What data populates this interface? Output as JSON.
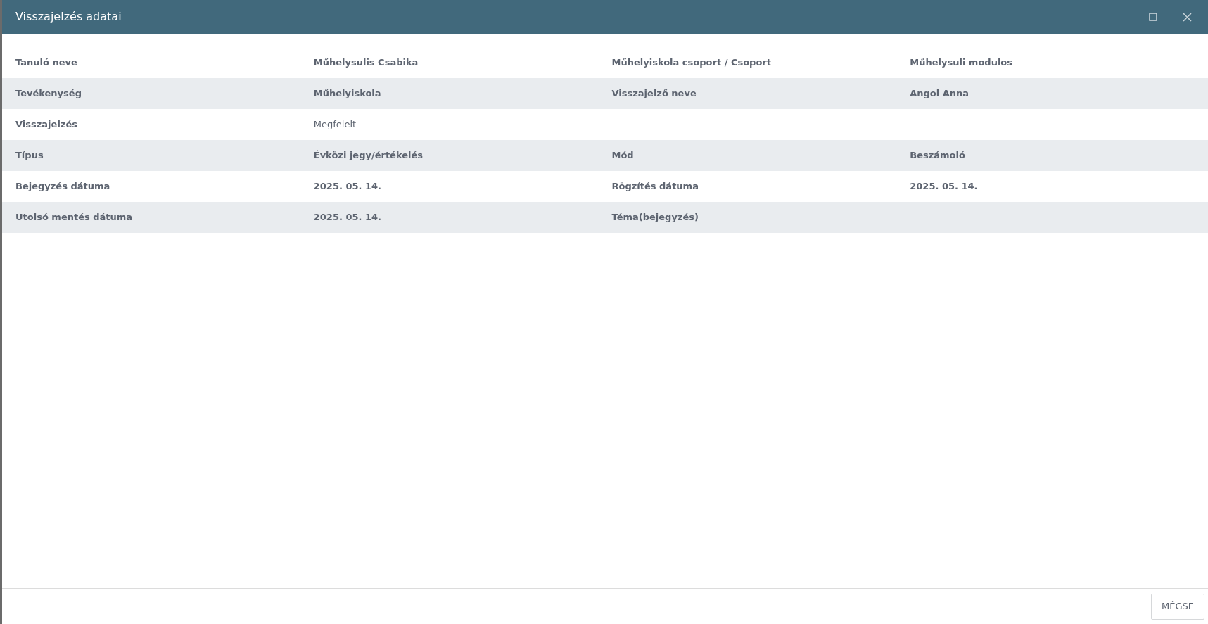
{
  "window": {
    "title": "Visszajelzés adatai"
  },
  "rows": [
    {
      "fields": [
        {
          "label": "Tanuló neve",
          "value": "Műhelysulis Csabika",
          "bold": true
        },
        {
          "label": "Műhelyiskola csoport / Csoport",
          "value": "Műhelysuli modulos",
          "bold": true
        }
      ]
    },
    {
      "fields": [
        {
          "label": "Tevékenység",
          "value": "Műhelyiskola",
          "bold": true
        },
        {
          "label": "Visszajelző neve",
          "value": "Angol Anna",
          "bold": true
        }
      ]
    },
    {
      "fields": [
        {
          "label": "Visszajelzés",
          "value": "Megfelelt",
          "bold": false
        }
      ]
    },
    {
      "fields": [
        {
          "label": "Típus",
          "value": "Évközi jegy/értékelés",
          "bold": true
        },
        {
          "label": "Mód",
          "value": "Beszámoló",
          "bold": true
        }
      ]
    },
    {
      "fields": [
        {
          "label": "Bejegyzés dátuma",
          "value": "2025. 05. 14.",
          "bold": true
        },
        {
          "label": "Rögzítés dátuma",
          "value": "2025. 05. 14.",
          "bold": true
        }
      ]
    },
    {
      "fields": [
        {
          "label": "Utolsó mentés dátuma",
          "value": "2025. 05. 14.",
          "bold": true
        },
        {
          "label": "Téma(bejegyzés)"
        }
      ]
    }
  ],
  "footer": {
    "buttons": [
      "MÉGSE"
    ]
  }
}
